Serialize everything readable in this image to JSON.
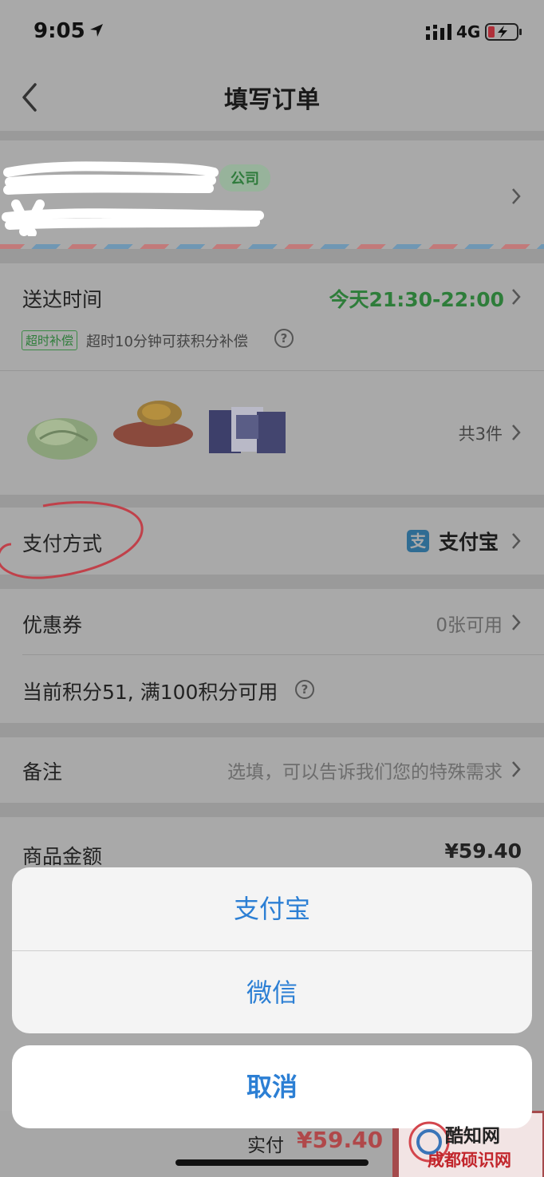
{
  "status_bar": {
    "time": "9:05",
    "network": "4G"
  },
  "nav": {
    "title": "填写订单"
  },
  "address": {
    "tag": "公司"
  },
  "delivery": {
    "label": "送达时间",
    "value": "今天21:30-22:00",
    "overtime_badge": "超时补偿",
    "overtime_text": "超时10分钟可获积分补偿"
  },
  "goods": {
    "count_text": "共3件"
  },
  "payment": {
    "label": "支付方式",
    "method": "支付宝",
    "icon": "alipay-icon"
  },
  "coupon": {
    "label": "优惠券",
    "value": "0张可用"
  },
  "points": {
    "text": "当前积分51, 满100积分可用"
  },
  "note": {
    "label": "备注",
    "placeholder": "选填，可以告诉我们您的特殊需求"
  },
  "amount": {
    "label": "商品金额",
    "value": "¥59.40"
  },
  "bottom": {
    "paid_label": "实付",
    "paid_value": "¥59.40"
  },
  "action_sheet": {
    "options": [
      {
        "label": "支付宝"
      },
      {
        "label": "微信"
      }
    ],
    "cancel_label": "取消"
  },
  "watermark": {
    "line1": "酷知网",
    "line2": "成都硕识网"
  },
  "colors": {
    "accent_green": "#2e7d3a",
    "sheet_blue": "#2c7fd4",
    "price_red": "#b0484a"
  }
}
